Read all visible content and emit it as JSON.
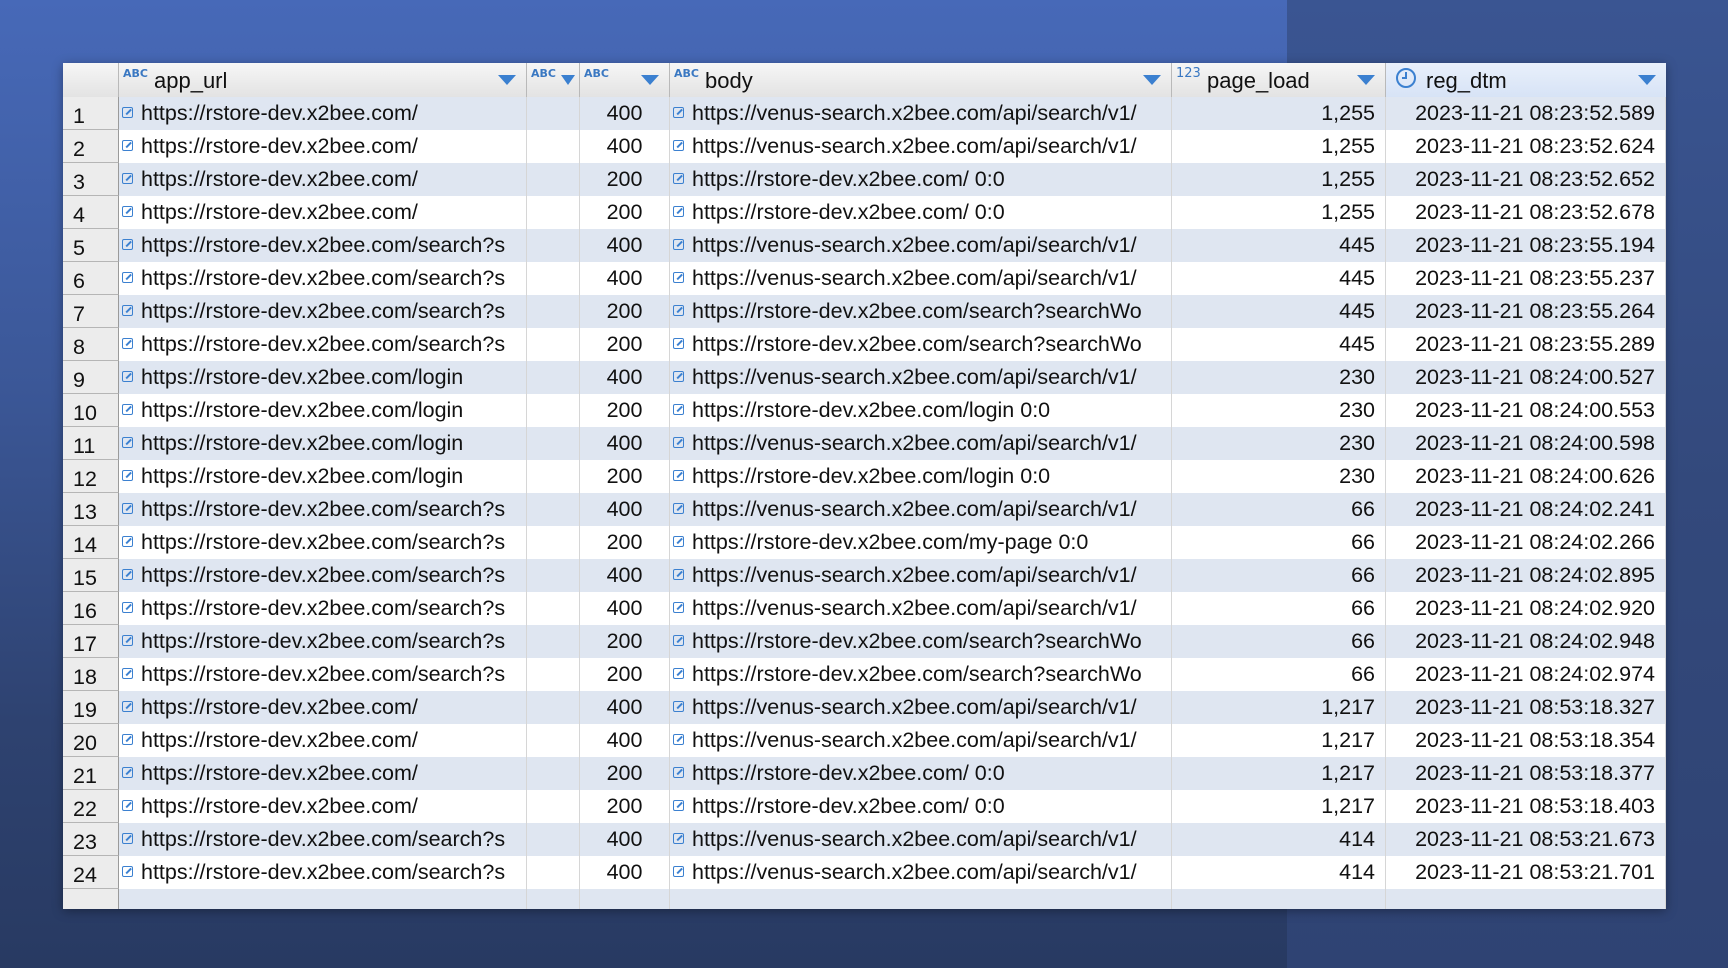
{
  "columns": [
    {
      "name": "row_number",
      "label": "",
      "type_tag": ""
    },
    {
      "name": "app_url",
      "label": "app_url",
      "type_tag": "ABC"
    },
    {
      "name": "narrow",
      "label": "",
      "type_tag": "ABC"
    },
    {
      "name": "status",
      "label": "",
      "type_tag": "ABC"
    },
    {
      "name": "body",
      "label": "body",
      "type_tag": "ABC"
    },
    {
      "name": "page_load",
      "label": "page_load",
      "type_tag": "123"
    },
    {
      "name": "reg_dtm",
      "label": "reg_dtm",
      "type_tag": "clock-icon"
    }
  ],
  "rows": [
    {
      "n": "1",
      "app_url": "https://rstore-dev.x2bee.com/",
      "status": "400",
      "body": "https://venus-search.x2bee.com/api/search/v1/",
      "page_load": "1,255",
      "reg_dtm": "2023-11-21 08:23:52.589"
    },
    {
      "n": "2",
      "app_url": "https://rstore-dev.x2bee.com/",
      "status": "400",
      "body": "https://venus-search.x2bee.com/api/search/v1/",
      "page_load": "1,255",
      "reg_dtm": "2023-11-21 08:23:52.624"
    },
    {
      "n": "3",
      "app_url": "https://rstore-dev.x2bee.com/",
      "status": "200",
      "body": "https://rstore-dev.x2bee.com/ 0:0",
      "page_load": "1,255",
      "reg_dtm": "2023-11-21 08:23:52.652"
    },
    {
      "n": "4",
      "app_url": "https://rstore-dev.x2bee.com/",
      "status": "200",
      "body": "https://rstore-dev.x2bee.com/ 0:0",
      "page_load": "1,255",
      "reg_dtm": "2023-11-21 08:23:52.678"
    },
    {
      "n": "5",
      "app_url": "https://rstore-dev.x2bee.com/search?s",
      "status": "400",
      "body": "https://venus-search.x2bee.com/api/search/v1/",
      "page_load": "445",
      "reg_dtm": "2023-11-21 08:23:55.194"
    },
    {
      "n": "6",
      "app_url": "https://rstore-dev.x2bee.com/search?s",
      "status": "400",
      "body": "https://venus-search.x2bee.com/api/search/v1/",
      "page_load": "445",
      "reg_dtm": "2023-11-21 08:23:55.237"
    },
    {
      "n": "7",
      "app_url": "https://rstore-dev.x2bee.com/search?s",
      "status": "200",
      "body": "https://rstore-dev.x2bee.com/search?searchWo",
      "page_load": "445",
      "reg_dtm": "2023-11-21 08:23:55.264"
    },
    {
      "n": "8",
      "app_url": "https://rstore-dev.x2bee.com/search?s",
      "status": "200",
      "body": "https://rstore-dev.x2bee.com/search?searchWo",
      "page_load": "445",
      "reg_dtm": "2023-11-21 08:23:55.289"
    },
    {
      "n": "9",
      "app_url": "https://rstore-dev.x2bee.com/login",
      "status": "400",
      "body": "https://venus-search.x2bee.com/api/search/v1/",
      "page_load": "230",
      "reg_dtm": "2023-11-21 08:24:00.527"
    },
    {
      "n": "10",
      "app_url": "https://rstore-dev.x2bee.com/login",
      "status": "200",
      "body": "https://rstore-dev.x2bee.com/login 0:0",
      "page_load": "230",
      "reg_dtm": "2023-11-21 08:24:00.553"
    },
    {
      "n": "11",
      "app_url": "https://rstore-dev.x2bee.com/login",
      "status": "400",
      "body": "https://venus-search.x2bee.com/api/search/v1/",
      "page_load": "230",
      "reg_dtm": "2023-11-21 08:24:00.598"
    },
    {
      "n": "12",
      "app_url": "https://rstore-dev.x2bee.com/login",
      "status": "200",
      "body": "https://rstore-dev.x2bee.com/login 0:0",
      "page_load": "230",
      "reg_dtm": "2023-11-21 08:24:00.626"
    },
    {
      "n": "13",
      "app_url": "https://rstore-dev.x2bee.com/search?s",
      "status": "400",
      "body": "https://venus-search.x2bee.com/api/search/v1/",
      "page_load": "66",
      "reg_dtm": "2023-11-21 08:24:02.241"
    },
    {
      "n": "14",
      "app_url": "https://rstore-dev.x2bee.com/search?s",
      "status": "200",
      "body": "https://rstore-dev.x2bee.com/my-page 0:0",
      "page_load": "66",
      "reg_dtm": "2023-11-21 08:24:02.266"
    },
    {
      "n": "15",
      "app_url": "https://rstore-dev.x2bee.com/search?s",
      "status": "400",
      "body": "https://venus-search.x2bee.com/api/search/v1/",
      "page_load": "66",
      "reg_dtm": "2023-11-21 08:24:02.895"
    },
    {
      "n": "16",
      "app_url": "https://rstore-dev.x2bee.com/search?s",
      "status": "400",
      "body": "https://venus-search.x2bee.com/api/search/v1/",
      "page_load": "66",
      "reg_dtm": "2023-11-21 08:24:02.920"
    },
    {
      "n": "17",
      "app_url": "https://rstore-dev.x2bee.com/search?s",
      "status": "200",
      "body": "https://rstore-dev.x2bee.com/search?searchWo",
      "page_load": "66",
      "reg_dtm": "2023-11-21 08:24:02.948"
    },
    {
      "n": "18",
      "app_url": "https://rstore-dev.x2bee.com/search?s",
      "status": "200",
      "body": "https://rstore-dev.x2bee.com/search?searchWo",
      "page_load": "66",
      "reg_dtm": "2023-11-21 08:24:02.974"
    },
    {
      "n": "19",
      "app_url": "https://rstore-dev.x2bee.com/",
      "status": "400",
      "body": "https://venus-search.x2bee.com/api/search/v1/",
      "page_load": "1,217",
      "reg_dtm": "2023-11-21 08:53:18.327"
    },
    {
      "n": "20",
      "app_url": "https://rstore-dev.x2bee.com/",
      "status": "400",
      "body": "https://venus-search.x2bee.com/api/search/v1/",
      "page_load": "1,217",
      "reg_dtm": "2023-11-21 08:53:18.354"
    },
    {
      "n": "21",
      "app_url": "https://rstore-dev.x2bee.com/",
      "status": "200",
      "body": "https://rstore-dev.x2bee.com/ 0:0",
      "page_load": "1,217",
      "reg_dtm": "2023-11-21 08:53:18.377"
    },
    {
      "n": "22",
      "app_url": "https://rstore-dev.x2bee.com/",
      "status": "200",
      "body": "https://rstore-dev.x2bee.com/ 0:0",
      "page_load": "1,217",
      "reg_dtm": "2023-11-21 08:53:18.403"
    },
    {
      "n": "23",
      "app_url": "https://rstore-dev.x2bee.com/search?s",
      "status": "400",
      "body": "https://venus-search.x2bee.com/api/search/v1/",
      "page_load": "414",
      "reg_dtm": "2023-11-21 08:53:21.673"
    },
    {
      "n": "24",
      "app_url": "https://rstore-dev.x2bee.com/search?s",
      "status": "400",
      "body": "https://venus-search.x2bee.com/api/search/v1/",
      "page_load": "414",
      "reg_dtm": "2023-11-21 08:53:21.701"
    }
  ],
  "colors": {
    "accent": "#3b80d0",
    "row_alt": "#dfe6f1",
    "background": "#3b5797"
  }
}
